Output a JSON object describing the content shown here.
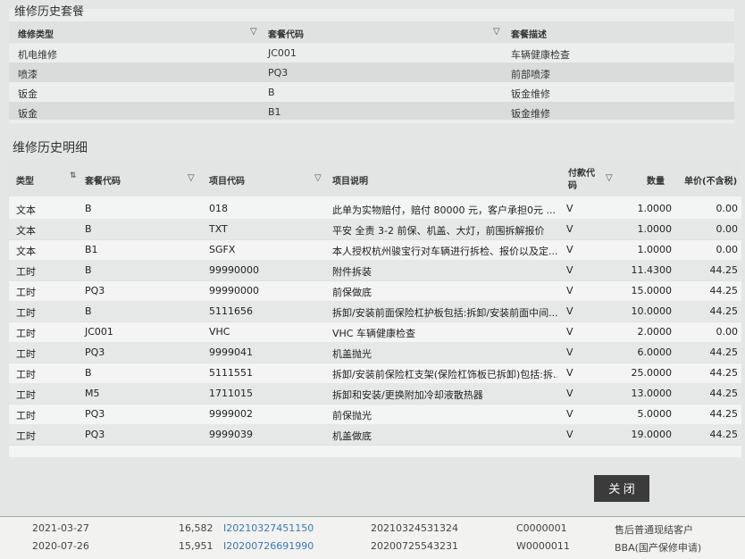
{
  "history_packages": {
    "title": "维修历史套餐",
    "columns": [
      "维修类型",
      "套餐代码",
      "套餐描述"
    ],
    "rows": [
      {
        "type": "机电维修",
        "code": "JC001",
        "desc": "车辆健康检查"
      },
      {
        "type": "喷漆",
        "code": "PQ3",
        "desc": "前部喷漆"
      },
      {
        "type": "钣金",
        "code": "B",
        "desc": "钣金维修"
      },
      {
        "type": "钣金",
        "code": "B1",
        "desc": "钣金维修"
      }
    ]
  },
  "history_details": {
    "title": "维修历史明细",
    "columns": [
      "类型",
      "套餐代码",
      "项目代码",
      "项目说明",
      "付款代码",
      "数量",
      "单价(不含税)"
    ],
    "rows": [
      {
        "type": "文本",
        "pkg": "B",
        "item": "018",
        "desc": "此单为实物赔付，赔付 80000 元，客户承担0元 ...",
        "pay": "V",
        "qty": "1.0000",
        "price": "0.00"
      },
      {
        "type": "文本",
        "pkg": "B",
        "item": "TXT",
        "desc": "平安 全责 3-2 前保、机盖、大灯，前围拆解报价",
        "pay": "V",
        "qty": "1.0000",
        "price": "0.00"
      },
      {
        "type": "文本",
        "pkg": "B1",
        "item": "SGFX",
        "desc": "本人授权杭州骏宝行对车辆进行拆检、报价以及定...",
        "pay": "V",
        "qty": "1.0000",
        "price": "0.00"
      },
      {
        "type": "工时",
        "pkg": "B",
        "item": "99990000",
        "desc": "附件拆装",
        "pay": "V",
        "qty": "11.4300",
        "price": "44.25"
      },
      {
        "type": "工时",
        "pkg": "PQ3",
        "item": "99990000",
        "desc": "前保做底",
        "pay": "V",
        "qty": "15.0000",
        "price": "44.25"
      },
      {
        "type": "工时",
        "pkg": "B",
        "item": "5111656",
        "desc": "拆卸/安装前面保险杠护板包括:拆卸/安装前面中间...",
        "pay": "V",
        "qty": "10.0000",
        "price": "44.25"
      },
      {
        "type": "工时",
        "pkg": "JC001",
        "item": "VHC",
        "desc": "VHC 车辆健康检查",
        "pay": "V",
        "qty": "2.0000",
        "price": "0.00"
      },
      {
        "type": "工时",
        "pkg": "PQ3",
        "item": "9999041",
        "desc": "机盖抛光",
        "pay": "V",
        "qty": "6.0000",
        "price": "44.25"
      },
      {
        "type": "工时",
        "pkg": "B",
        "item": "5111551",
        "desc": "拆卸/安装前保险杠支架(保险杠饰板已拆卸)包括:拆...",
        "pay": "V",
        "qty": "25.0000",
        "price": "44.25"
      },
      {
        "type": "工时",
        "pkg": "M5",
        "item": "1711015",
        "desc": "拆卸和安装/更换附加冷却液散热器",
        "pay": "V",
        "qty": "13.0000",
        "price": "44.25"
      },
      {
        "type": "工时",
        "pkg": "PQ3",
        "item": "9999002",
        "desc": "前保抛光",
        "pay": "V",
        "qty": "5.0000",
        "price": "44.25"
      },
      {
        "type": "工时",
        "pkg": "PQ3",
        "item": "9999039",
        "desc": "机盖做底",
        "pay": "V",
        "qty": "19.0000",
        "price": "44.25"
      }
    ]
  },
  "close_label": "关 闭",
  "background_rows": [
    {
      "date": "2021-03-27",
      "amount": "16,582",
      "link": "I20210327451150",
      "ro": "20210324531324",
      "code": "C0000001",
      "customer": "售后普通现结客户"
    },
    {
      "date": "2020-07-26",
      "amount": "15,951",
      "link": "I20200726691990",
      "ro": "20200725543231",
      "code": "W0000011",
      "customer": "BBA(国产保修申请)"
    }
  ]
}
